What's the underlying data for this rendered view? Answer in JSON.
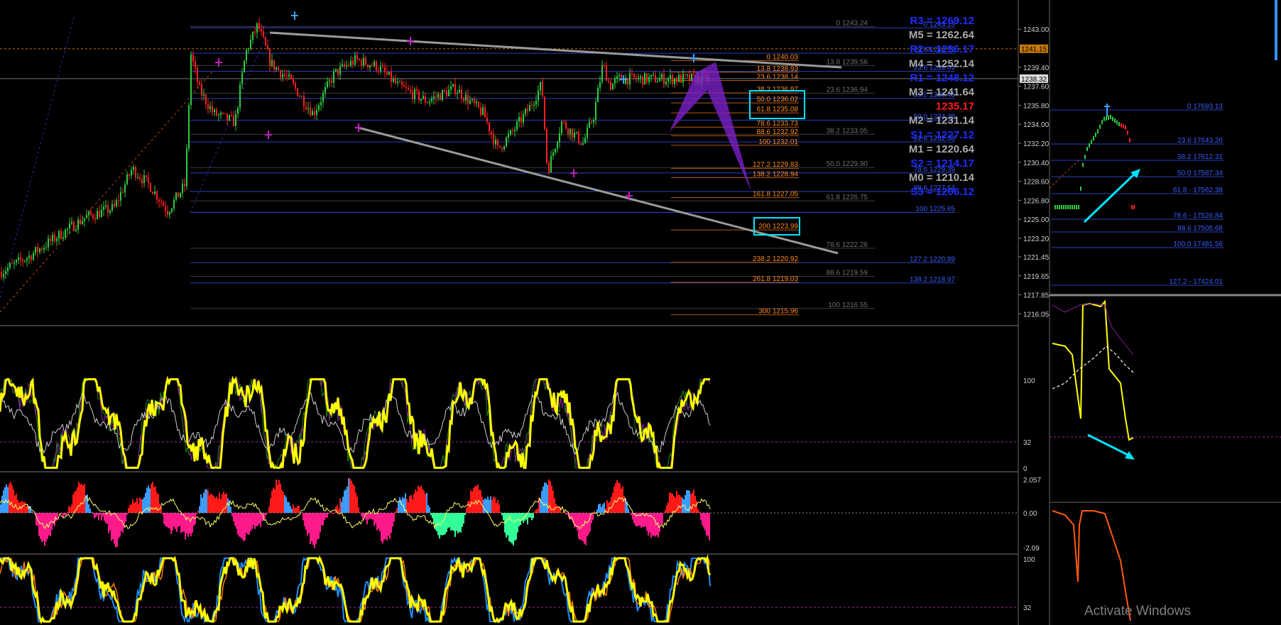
{
  "colors": {
    "background": "#000000",
    "candle_up": "#2ecc40",
    "candle_down": "#ff2020",
    "fib_orange": "#ff8c1a",
    "fib_blue": "#3a5bff",
    "fib_gray": "#6e6e6e",
    "pivot_blue": "#1e2dff",
    "pivot_gray": "#aaaaaa",
    "pivot_red": "#ff1a1a",
    "trendline": "#9a9a9a",
    "pattern": "#7a20c8",
    "highlight": "#00e5ff",
    "oscillator": "#ffff00"
  },
  "chart_data": [
    {
      "type": "line",
      "title": "",
      "ylabel": "",
      "ylim": [
        1215.2,
        1245.5
      ],
      "y_ticks": [
        "1243.00",
        "1239.40",
        "1237.60",
        "1235.80",
        "1234.00",
        "1232.20",
        "1230.40",
        "1228.60",
        "1226.80",
        "1225.00",
        "1223.20",
        "1221.45",
        "1219.65",
        "1217.85",
        "1216.05"
      ],
      "y_tick_values": [
        1243.0,
        1239.4,
        1237.6,
        1235.8,
        1234.0,
        1232.2,
        1230.4,
        1228.6,
        1226.8,
        1225.0,
        1223.2,
        1221.45,
        1219.65,
        1217.85,
        1216.05
      ],
      "price_badges": [
        {
          "label": "1241.15",
          "value": 1241.15
        },
        {
          "label": "1238.32",
          "value": 1238.32
        }
      ],
      "close_path": [
        [
          0,
          1220.0
        ],
        [
          40,
          1221.5
        ],
        [
          80,
          1223.4
        ],
        [
          120,
          1225.2
        ],
        [
          160,
          1226.1
        ],
        [
          185,
          1229.8
        ],
        [
          210,
          1228.2
        ],
        [
          235,
          1225.8
        ],
        [
          260,
          1228.3
        ],
        [
          268,
          1240.6
        ],
        [
          280,
          1237.2
        ],
        [
          300,
          1235.0
        ],
        [
          330,
          1234.2
        ],
        [
          345,
          1240.8
        ],
        [
          362,
          1243.4
        ],
        [
          380,
          1239.8
        ],
        [
          405,
          1238.3
        ],
        [
          440,
          1235.0
        ],
        [
          470,
          1238.8
        ],
        [
          500,
          1240.1
        ],
        [
          530,
          1239.5
        ],
        [
          560,
          1237.6
        ],
        [
          600,
          1236.2
        ],
        [
          640,
          1237.4
        ],
        [
          680,
          1235.0
        ],
        [
          700,
          1231.6
        ],
        [
          720,
          1233.2
        ],
        [
          745,
          1235.6
        ],
        [
          762,
          1237.8
        ],
        [
          770,
          1229.5
        ],
        [
          790,
          1234.2
        ],
        [
          820,
          1232.2
        ],
        [
          835,
          1234.8
        ],
        [
          848,
          1239.7
        ],
        [
          858,
          1237.6
        ],
        [
          870,
          1238.3
        ]
      ],
      "pivots": [
        {
          "label": "R3 = 1269.12",
          "color": "blue"
        },
        {
          "label": "M5 = 1262.64",
          "color": "gray"
        },
        {
          "label": "R2 = 1256.17",
          "color": "blue"
        },
        {
          "label": "M4 = 1252.14",
          "color": "gray"
        },
        {
          "label": "R1 = 1248.12",
          "color": "blue"
        },
        {
          "label": "M3 = 1241.64",
          "color": "gray"
        },
        {
          "label": "1235.17",
          "color": "red"
        },
        {
          "label": "M2 = 1231.14",
          "color": "gray"
        },
        {
          "label": "S1 = 1227.12",
          "color": "blue"
        },
        {
          "label": "M1 = 1220.64",
          "color": "gray"
        },
        {
          "label": "S2 = 1214.17",
          "color": "blue"
        },
        {
          "label": "M0 = 1210.14",
          "color": "gray"
        },
        {
          "label": "S3 = 1206.12",
          "color": "blue"
        }
      ],
      "fib_gray": [
        "0 1243.24",
        "13.8 1239.56",
        "23.6 1236.94",
        "38.2 1233.05",
        "50.0 1229.90",
        "61.8 1226.75",
        "78.6 1222.26",
        "88.6 1219.59",
        "100 1216.55"
      ],
      "fib_blue": [
        "0 1243.13",
        "13.8 1240.72",
        "23.6 1239.01",
        "38.2 1236.45",
        "50.0 1234.39",
        "61.8 1232.33",
        "78.6 1229.39",
        "88.6 1227.64",
        "100 1225.65",
        "127.2 1220.89",
        "138.2 1218.97"
      ],
      "fib_orange": [
        "0 1240.03",
        "13.8 1238.93",
        "23.6 1238.14",
        "38.2 1236.97",
        "50.0 1236.02",
        "61.8 1235.08",
        "78.6 1233.73",
        "88.6 1232.92",
        "100 1232.01",
        "127.2 1229.83",
        "138.2 1228.94",
        "161.8 1227.05",
        "200 1223.99",
        "238.2 1220.92",
        "261.8 1219.03",
        "300 1215.96"
      ]
    },
    {
      "type": "line",
      "title": "",
      "ylim": [
        0,
        100
      ],
      "y_ticks": [
        "100",
        "32",
        "0"
      ],
      "level": 32
    },
    {
      "type": "area",
      "title": "",
      "ylim": [
        -2.09,
        2.057
      ],
      "y_ticks": [
        "2.057",
        "0.00",
        "-2.09"
      ]
    },
    {
      "type": "line",
      "title": "",
      "ylim": [
        0,
        100
      ],
      "y_ticks": [
        "100",
        "32"
      ],
      "level": 32
    },
    {
      "type": "line",
      "title": "",
      "fib_levels": [
        "0 17693.13",
        "23.6 17643.20",
        "38.2 17612.31",
        "50.0 17587.34",
        "61.8 - 17562.38",
        "78.6 - 17526.84",
        "88.6 17505.68",
        "100.0 17481.56",
        "127.2 - 17424.01"
      ]
    }
  ],
  "watermark": "Activate Windows"
}
